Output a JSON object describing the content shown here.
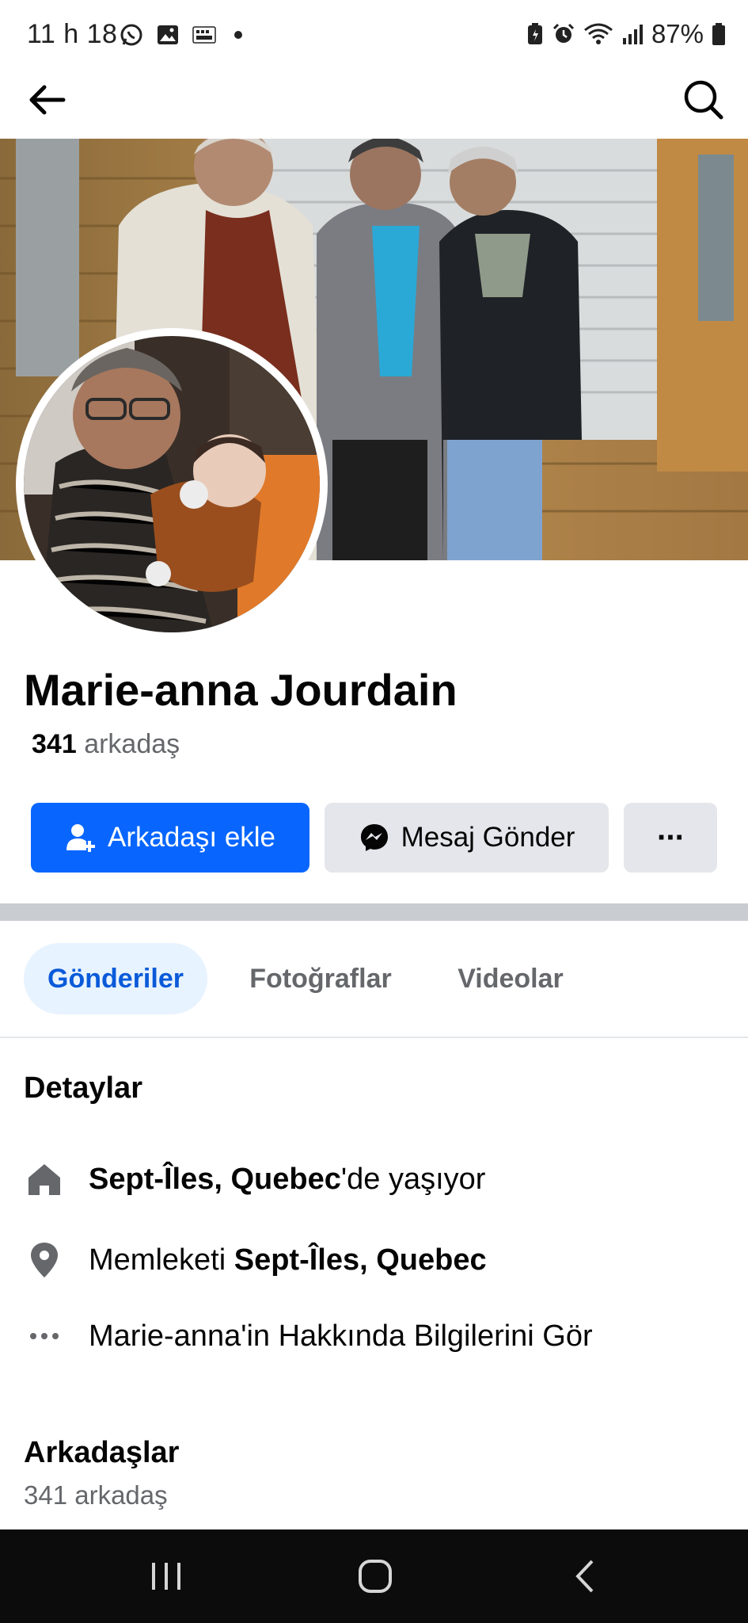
{
  "status_bar": {
    "time": "11 h 18",
    "battery": "87%",
    "left_icons": [
      "whatsapp-icon",
      "gallery-icon",
      "temu-icon"
    ],
    "right_icons": [
      "battery-saver-icon",
      "alarm-icon",
      "wifi-icon",
      "signal-icon",
      "battery-icon"
    ]
  },
  "header": {
    "back_icon": "arrow-left-icon",
    "search_icon": "search-icon"
  },
  "profile": {
    "name": "Marie-anna Jourdain",
    "friend_count": "341",
    "friend_label": "arkadaş"
  },
  "actions": {
    "add_friend": "Arkadaşı ekle",
    "message": "Mesaj Gönder",
    "more": "···"
  },
  "tabs": [
    {
      "label": "Gönderiler",
      "active": true
    },
    {
      "label": "Fotoğraflar",
      "active": false
    },
    {
      "label": "Videolar",
      "active": false
    }
  ],
  "details": {
    "title": "Detaylar",
    "lives_in_place": "Sept-Îles, Quebec",
    "lives_in_suffix": "'de yaşıyor",
    "hometown_prefix": "Memleketi ",
    "hometown_place": "Sept-Îles, Quebec",
    "about_link": "Marie-anna'in Hakkında Bilgilerini Gör"
  },
  "friends_section": {
    "title": "Arkadaşlar",
    "subtitle": "341 arkadaş"
  },
  "colors": {
    "primary": "#0866ff",
    "tab_active_bg": "#e7f3ff",
    "tab_active_text": "#0a5ad9",
    "secondary_button": "#e4e6eb",
    "muted_text": "#65676b"
  }
}
